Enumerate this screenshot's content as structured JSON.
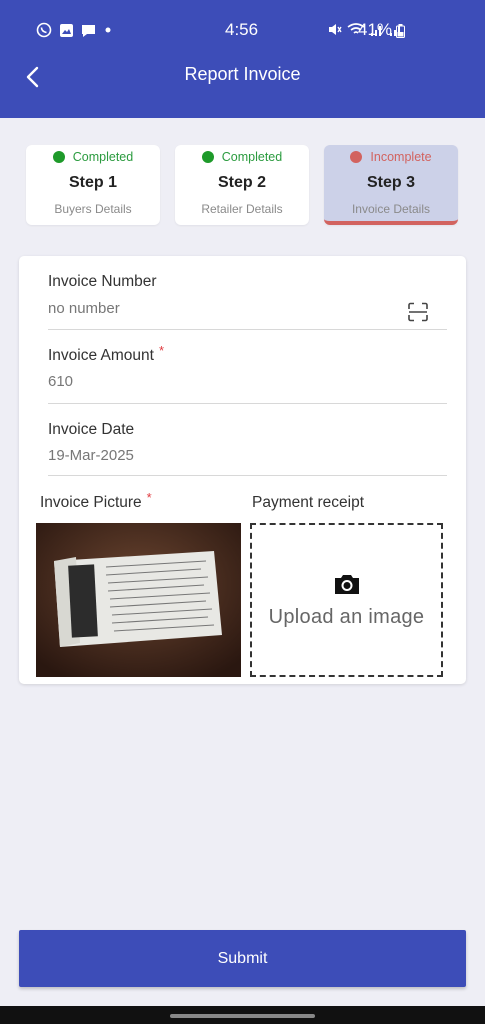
{
  "status_bar": {
    "time": "4:56",
    "battery": "41%",
    "icons": [
      "whatsapp-icon",
      "gallery-icon",
      "message-icon",
      "dot-icon",
      "mute-icon",
      "wifi-icon",
      "signal-icon",
      "signal-icon",
      "battery-icon"
    ]
  },
  "header": {
    "title": "Report Invoice",
    "back_icon": "chevron-left-icon"
  },
  "steps": [
    {
      "status": "Completed",
      "label": "Step 1",
      "description": "Buyers Details",
      "status_color": "#2b9b3f"
    },
    {
      "status": "Completed",
      "label": "Step 2",
      "description": "Retailer Details",
      "status_color": "#2b9b3f"
    },
    {
      "status": "Incomplete",
      "label": "Step 3",
      "description": "Invoice Details",
      "status_color": "#d2635f"
    }
  ],
  "form": {
    "invoice_number": {
      "label": "Invoice Number",
      "placeholder": "no number"
    },
    "invoice_amount": {
      "label": "Invoice Amount",
      "required_mark": "*",
      "value": "610"
    },
    "invoice_date": {
      "label": "Invoice Date",
      "value": "19-Mar-2025"
    },
    "invoice_picture": {
      "label": "Invoice Picture",
      "required_mark": "*"
    },
    "payment_receipt": {
      "label": "Payment receipt",
      "upload_text": "Upload an image"
    }
  },
  "submit_label": "Submit",
  "colors": {
    "primary": "#3d4db8",
    "incomplete": "#d2635f",
    "complete": "#2b9b3f",
    "background": "#eeeef5"
  }
}
